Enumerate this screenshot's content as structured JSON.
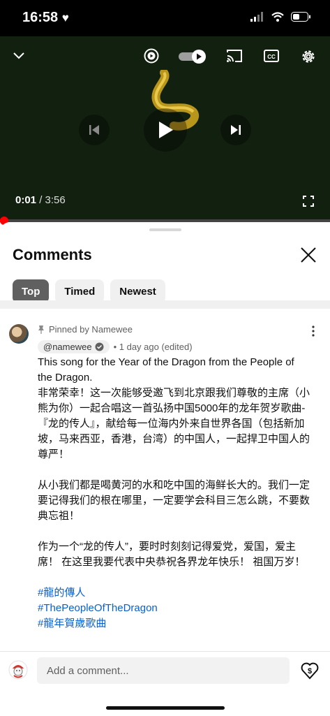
{
  "status": {
    "time": "16:58"
  },
  "player": {
    "current_time": "0:01",
    "duration": "/ 3:56",
    "progress_fraction": 0.004
  },
  "comments": {
    "title": "Comments",
    "chips": [
      {
        "label": "Top"
      },
      {
        "label": "Timed"
      },
      {
        "label": "Newest"
      }
    ],
    "pinned": {
      "pinned_label": "Pinned by Namewee",
      "author": "@namewee",
      "meta": "• 1 day ago (edited)",
      "lines": [
        "This song for the Year of the Dragon from the People of the Dragon.",
        "非常荣幸！这一次能够受邀飞到北京跟我们尊敬的主席（小熊为你）一起合唱这一首弘扬中国5000年的龙年贺岁歌曲-『龙的传人』，献给每一位海内外来自世界各国（包括新加坡，马来西亚，香港，台湾）的中国人，一起捍卫中国人的尊严！",
        "从小我们都是喝黄河的水和吃中国的海鲜长大的。我们一定要记得我们的根在哪里，一定要学会科目三怎么跳，不要数典忘祖！",
        "作为一个“龙的传人”，要时时刻刻记得爱党，爱国，爱主席！ 在这里我要代表中央恭祝各界龙年快乐！ 祖国万岁！"
      ],
      "hashtags": [
        "#龍的傳人",
        "#ThePeopleOfTheDragon",
        "#龍年賀歲歌曲"
      ]
    }
  },
  "composer": {
    "placeholder": "Add a comment..."
  }
}
